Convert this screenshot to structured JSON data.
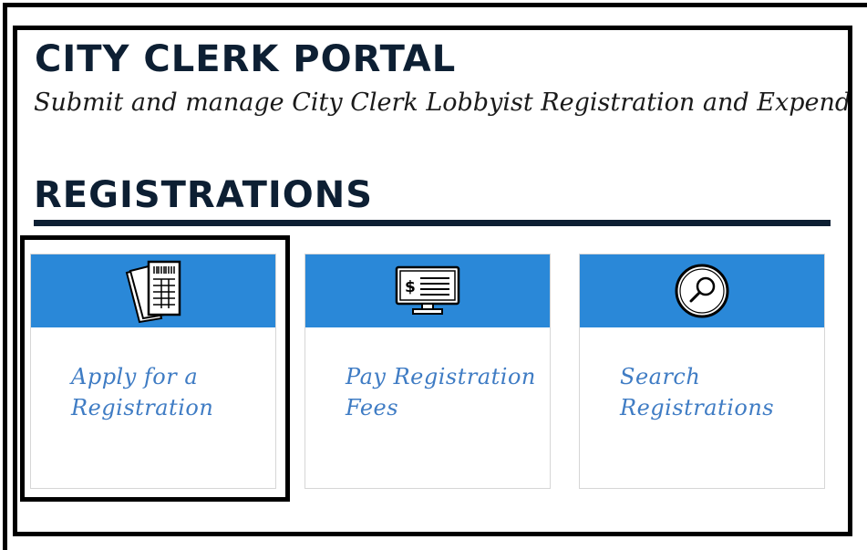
{
  "portal": {
    "title": "CITY CLERK PORTAL",
    "subtitle": "Submit and manage City Clerk Lobbyist Registration and Expenditure Filings"
  },
  "registrations": {
    "heading": "REGISTRATIONS",
    "cards": [
      {
        "label": "Apply for a Registration",
        "icon": "registration-form-icon"
      },
      {
        "label": "Pay Registration Fees",
        "icon": "payment-monitor-icon"
      },
      {
        "label": "Search Registrations",
        "icon": "magnifier-icon"
      }
    ]
  },
  "colors": {
    "banner": "#2a88d8",
    "link": "#3f7cc4",
    "heading": "#0d1f33"
  }
}
